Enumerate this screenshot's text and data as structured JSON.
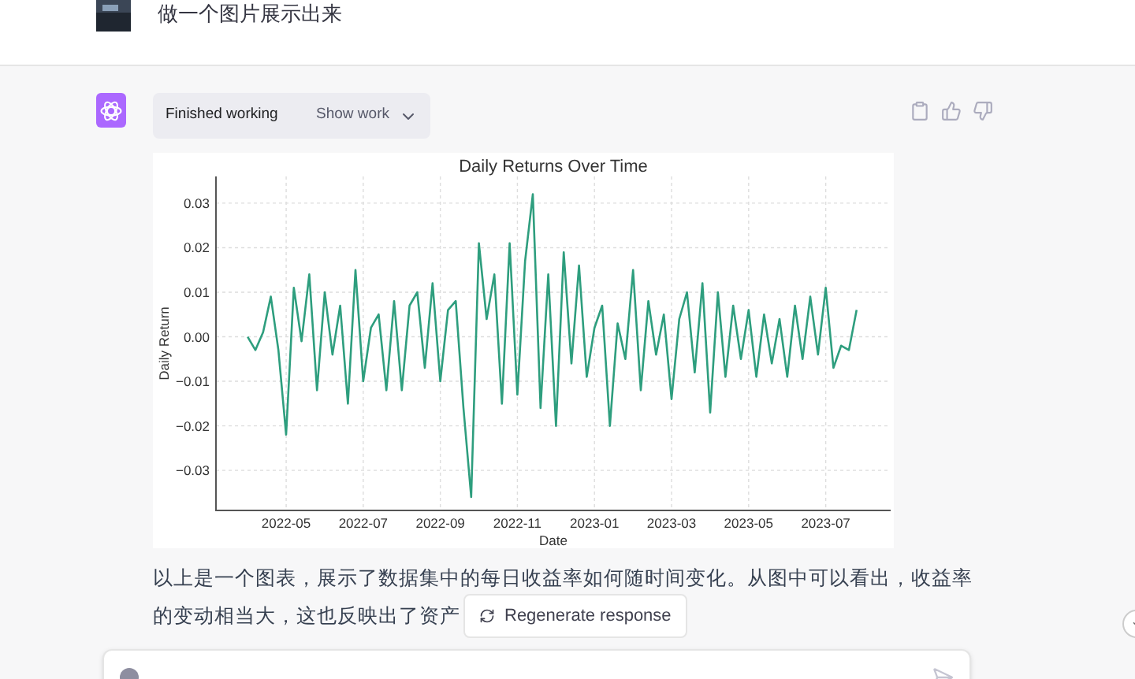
{
  "user_message": {
    "text": "做一个图片展示出来"
  },
  "assistant": {
    "status": {
      "label": "Finished working",
      "toggle": "Show work"
    },
    "chart": {
      "chart_data": {
        "type": "line",
        "title": "Daily Returns Over Time",
        "xlabel": "Date",
        "ylabel": "Daily Return",
        "grid": true,
        "categories": [
          null,
          null,
          null,
          null,
          null,
          "2022-05",
          null,
          null,
          null,
          null,
          null,
          null,
          null,
          null,
          null,
          "2022-07",
          null,
          null,
          null,
          null,
          null,
          null,
          null,
          null,
          null,
          "2022-09",
          null,
          null,
          null,
          null,
          null,
          null,
          null,
          null,
          null,
          "2022-11",
          null,
          null,
          null,
          null,
          null,
          null,
          null,
          null,
          null,
          "2023-01",
          null,
          null,
          null,
          null,
          null,
          null,
          null,
          null,
          null,
          "2023-03",
          null,
          null,
          null,
          null,
          null,
          null,
          null,
          null,
          null,
          "2023-05",
          null,
          null,
          null,
          null,
          null,
          null,
          null,
          null,
          null,
          "2023-07",
          null,
          null,
          null,
          null
        ],
        "ylim": [
          -0.039,
          0.036
        ],
        "yticks": [
          {
            "value": 0.03,
            "label": "0.03"
          },
          {
            "value": 0.02,
            "label": "0.02"
          },
          {
            "value": 0.01,
            "label": "0.01"
          },
          {
            "value": 0,
            "label": "0.00"
          },
          {
            "value": -0.01,
            "label": "−0.01"
          },
          {
            "value": -0.02,
            "label": "−0.02"
          },
          {
            "value": -0.03,
            "label": "−0.03"
          }
        ],
        "series": [
          {
            "color": "#2e9e7e",
            "values": [
              0.0,
              -0.003,
              0.001,
              0.009,
              -0.003,
              -0.022,
              0.011,
              -0.001,
              0.014,
              -0.012,
              0.01,
              -0.004,
              0.007,
              -0.015,
              0.015,
              -0.01,
              0.002,
              0.005,
              -0.012,
              0.008,
              -0.012,
              0.007,
              0.01,
              -0.007,
              0.012,
              -0.01,
              0.006,
              0.008,
              -0.016,
              -0.036,
              0.021,
              0.004,
              0.014,
              -0.015,
              0.021,
              -0.013,
              0.017,
              0.032,
              -0.016,
              0.014,
              -0.02,
              0.019,
              -0.006,
              0.016,
              -0.009,
              0.002,
              0.007,
              -0.02,
              0.003,
              -0.005,
              0.015,
              -0.012,
              0.008,
              -0.004,
              0.005,
              -0.014,
              0.004,
              0.01,
              -0.008,
              0.012,
              -0.017,
              0.01,
              -0.009,
              0.007,
              -0.005,
              0.006,
              -0.009,
              0.005,
              -0.006,
              0.004,
              -0.009,
              0.007,
              -0.005,
              0.009,
              -0.004,
              0.011,
              -0.007,
              -0.002,
              -0.003,
              0.006
            ]
          }
        ]
      }
    },
    "text_lines": [
      "以上是一个图表，展示了数据集中的每日收益率如何随时间变化。从图中可以看出，收益率",
      "的变动相当大，这也反映出了资产"
    ]
  },
  "regenerate_button": {
    "label": "Regenerate response"
  }
}
